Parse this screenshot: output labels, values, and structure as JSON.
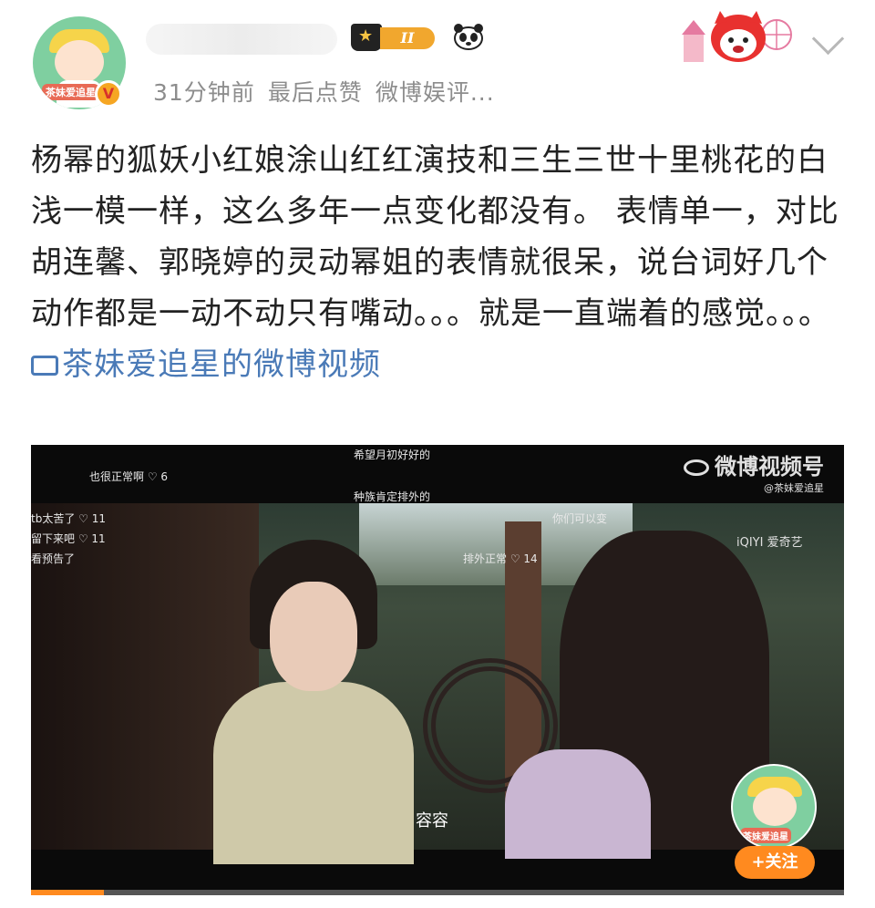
{
  "header": {
    "avatar_label": "茶妹爱追星",
    "verified_mark": "V",
    "vip_level": "II",
    "meta": [
      "31分钟前",
      "最后点赞",
      "微博娱评..."
    ]
  },
  "post": {
    "text": "杨幂的狐妖小红娘涂山红红演技和三生三世十里桃花的白浅一模一样，这么多年一点变化都没有。 表情单一，对比胡连馨、郭晓婷的灵动幂姐的表情就很呆，说台词好几个动作都是一动不动只有嘴动。。。就是一直端着的感觉。。。 ",
    "link_label": "茶妹爱追星的微博视频"
  },
  "video": {
    "danmaku": [
      "希望月初好好的",
      "也很正常啊 ♡ 6",
      "种族肯定排外的",
      "你们可以变",
      "tb太苦了 ♡ 11",
      "留下来吧 ♡ 11",
      "看预告了",
      "排外正常 ♡ 14"
    ],
    "watermark_main": "微博视频号",
    "watermark_sub": "@茶妹爱追星",
    "channel_logo": "iQIYI 爱奇艺",
    "subtitle": "容容",
    "float_avatar_label": "茶妹爱追星",
    "follow_label": "+关注",
    "progress": 0.09
  }
}
